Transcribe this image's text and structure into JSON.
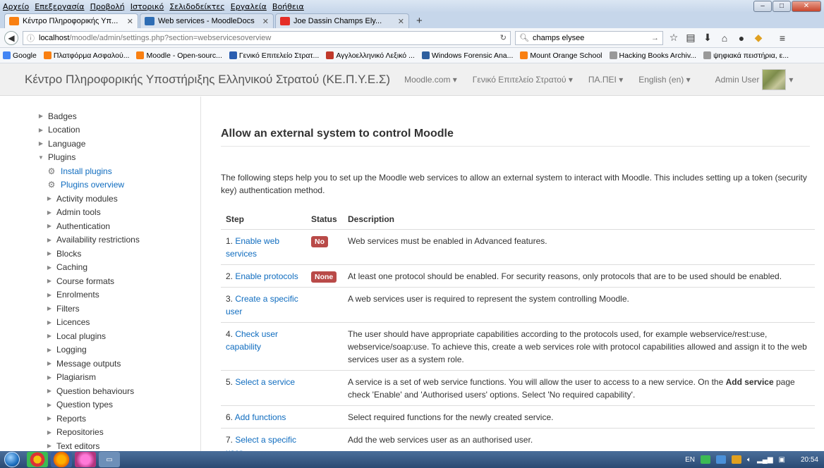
{
  "menubar": [
    "Αρχείο",
    "Επεξεργασία",
    "Προβολή",
    "Ιστορικό",
    "Σελιδοδείκτες",
    "Εργαλεία",
    "Βοήθεια"
  ],
  "tabs": [
    {
      "title": "Κέντρο Πληροφορικής Υπ...",
      "favicon": "moodle-icon",
      "color": "#f98012",
      "active": true
    },
    {
      "title": "Web services - MoodleDocs",
      "favicon": "moodle-docs-icon",
      "color": "#2e6db4",
      "active": false
    },
    {
      "title": "Joe Dassin Champs Ely...",
      "favicon": "youtube-icon",
      "color": "#e52d27",
      "active": false
    }
  ],
  "url": {
    "host": "localhost",
    "path": "/moodle/admin/settings.php?section=webservicesoverview"
  },
  "search": {
    "value": "champs elysee"
  },
  "bookmarks": [
    {
      "label": "Google",
      "color": "#4285f4"
    },
    {
      "label": "Πλατφόρμα Ασφαλού...",
      "color": "#f98012"
    },
    {
      "label": "Moodle - Open-sourc...",
      "color": "#f98012"
    },
    {
      "label": "Γενικό Επιτελείο Στρατ...",
      "color": "#2a5db0"
    },
    {
      "label": "Αγγλοελληνικό Λεξικό ...",
      "color": "#c0392b"
    },
    {
      "label": "Windows Forensic Ana...",
      "color": "#2e5f9e"
    },
    {
      "label": "Mount Orange School",
      "color": "#f98012"
    },
    {
      "label": "Hacking Books Archiv...",
      "color": "#999999"
    },
    {
      "label": "ψηφιακά πειστήρια, ε...",
      "color": "#999999"
    }
  ],
  "header": {
    "site_name": "Κέντρο Πληροφορικής Υποστήριξης Ελληνικού Στρατού (ΚΕ.Π.Υ.Ε.Σ)",
    "nav": [
      "Moodle.com ▾",
      "Γενικό Επιτελείο Στρατού ▾",
      "ΠΑ.ΠΕΙ ▾",
      "English (en) ▾"
    ],
    "user": "Admin User"
  },
  "sidebar": {
    "items": [
      {
        "label": "Badges",
        "type": "collapsed",
        "level": 1
      },
      {
        "label": "Location",
        "type": "collapsed",
        "level": 1
      },
      {
        "label": "Language",
        "type": "collapsed",
        "level": 1
      },
      {
        "label": "Plugins",
        "type": "expanded",
        "level": 1
      },
      {
        "label": "Install plugins",
        "type": "link",
        "level": 2
      },
      {
        "label": "Plugins overview",
        "type": "link",
        "level": 2
      },
      {
        "label": "Activity modules",
        "type": "collapsed",
        "level": 2
      },
      {
        "label": "Admin tools",
        "type": "collapsed",
        "level": 2
      },
      {
        "label": "Authentication",
        "type": "collapsed",
        "level": 2
      },
      {
        "label": "Availability restrictions",
        "type": "collapsed",
        "level": 2
      },
      {
        "label": "Blocks",
        "type": "collapsed",
        "level": 2
      },
      {
        "label": "Caching",
        "type": "collapsed",
        "level": 2
      },
      {
        "label": "Course formats",
        "type": "collapsed",
        "level": 2
      },
      {
        "label": "Enrolments",
        "type": "collapsed",
        "level": 2
      },
      {
        "label": "Filters",
        "type": "collapsed",
        "level": 2
      },
      {
        "label": "Licences",
        "type": "collapsed",
        "level": 2
      },
      {
        "label": "Local plugins",
        "type": "collapsed",
        "level": 2
      },
      {
        "label": "Logging",
        "type": "collapsed",
        "level": 2
      },
      {
        "label": "Message outputs",
        "type": "collapsed",
        "level": 2
      },
      {
        "label": "Plagiarism",
        "type": "collapsed",
        "level": 2
      },
      {
        "label": "Question behaviours",
        "type": "collapsed",
        "level": 2
      },
      {
        "label": "Question types",
        "type": "collapsed",
        "level": 2
      },
      {
        "label": "Reports",
        "type": "collapsed",
        "level": 2
      },
      {
        "label": "Repositories",
        "type": "collapsed",
        "level": 2
      },
      {
        "label": "Text editors",
        "type": "collapsed",
        "level": 2
      }
    ]
  },
  "main": {
    "title": "Allow an external system to control Moodle",
    "intro": "The following steps help you to set up the Moodle web services to allow an external system to interact with Moodle. This includes setting up a token (security key) authentication method.",
    "columns": [
      "Step",
      "Status",
      "Description"
    ],
    "rows": [
      {
        "step": "1. ",
        "link": "Enable web services",
        "status": "No",
        "desc": "Web services must be enabled in Advanced features."
      },
      {
        "step": "2. ",
        "link": "Enable protocols",
        "status": "None",
        "desc": "At least one protocol should be enabled. For security reasons, only protocols that are to be used should be enabled."
      },
      {
        "step": "3. ",
        "link": "Create a specific user",
        "status": "",
        "desc": "A web services user is required to represent the system controlling Moodle."
      },
      {
        "step": "4. ",
        "link": "Check user capability",
        "status": "",
        "desc": "The user should have appropriate capabilities according to the protocols used, for example webservice/rest:use, webservice/soap:use. To achieve this, create a web services role with protocol capabilities allowed and assign it to the web services user as a system role."
      },
      {
        "step": "5. ",
        "link": "Select a service",
        "status": "",
        "desc_pre": "A service is a set of web service functions. You will allow the user to access to a new service. On the ",
        "desc_bold": "Add service",
        "desc_post": " page check 'Enable' and 'Authorised users' options. Select 'No required capability'."
      },
      {
        "step": "6. ",
        "link": "Add functions",
        "status": "",
        "desc": "Select required functions for the newly created service."
      },
      {
        "step": "7. ",
        "link": "Select a specific user",
        "status": "",
        "desc": "Add the web services user as an authorised user."
      }
    ]
  },
  "taskbar": {
    "lang": "EN",
    "time": "20:54"
  }
}
